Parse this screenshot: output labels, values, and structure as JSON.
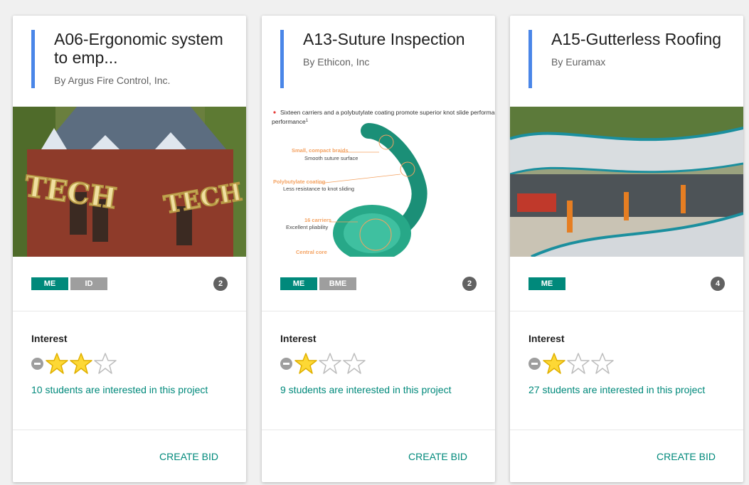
{
  "projects": [
    {
      "title": "A06-Ergonomic system to emp...",
      "owner": "By Argus Fire Control, Inc.",
      "image_icon": "tech-tower-photo",
      "tags": [
        "ME",
        "ID"
      ],
      "count": "2",
      "interest_label": "Interest",
      "rating": 2,
      "rating_max": 3,
      "interest_text": "10 students are interested in this project",
      "bid_label": "CREATE BID"
    },
    {
      "title": "A13-Suture Inspection",
      "owner": "By Ethicon, Inc",
      "image_icon": "suture-diagram",
      "image_text": {
        "bullet": "Sixteen carriers and a polybutylate coating promote superior knot slide performance",
        "sup": "1",
        "l1": "Small, compact braids",
        "l1s": "Smooth suture surface",
        "l2": "Polybutylate coating",
        "l2s": "Less resistance to knot sliding",
        "l3": "16 carriers",
        "l3s": "Excellent pliability",
        "l4": "Central core"
      },
      "tags": [
        "ME",
        "BME"
      ],
      "count": "2",
      "interest_label": "Interest",
      "rating": 1,
      "rating_max": 3,
      "interest_text": "9 students are interested in this project",
      "bid_label": "CREATE BID"
    },
    {
      "title": "A15-Gutterless Roofing",
      "owner": "By Euramax",
      "image_icon": "bus-station-roof-photo",
      "tags": [
        "ME"
      ],
      "count": "4",
      "interest_label": "Interest",
      "rating": 1,
      "rating_max": 3,
      "interest_text": "27 students are interested in this project",
      "bid_label": "CREATE BID"
    }
  ],
  "colors": {
    "accent": "#00897b",
    "title_bar": "#4a86e8",
    "star_fill": "#fdd835",
    "star_empty": "#bdbdbd"
  }
}
